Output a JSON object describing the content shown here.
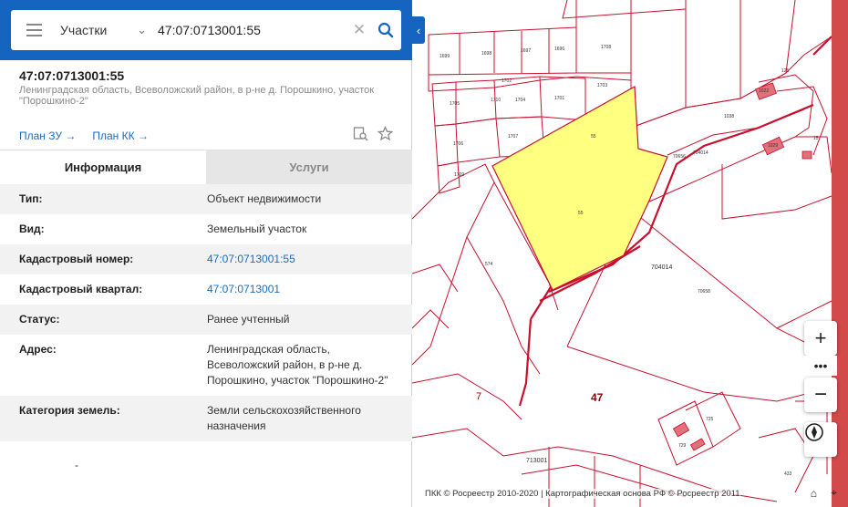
{
  "search": {
    "scope": "Участки",
    "query": "47:07:0713001:55"
  },
  "object": {
    "cadastral_number": "47:07:0713001:55",
    "address_short": "Ленинградская область, Всеволожский район, в р-не д. Порошкино, участок \"Порошкино-2\"",
    "link_plan_zu": "План ЗУ →",
    "link_plan_kk": "План КК →"
  },
  "tabs": [
    {
      "label": "Информация"
    },
    {
      "label": "Услуги"
    }
  ],
  "info": [
    {
      "key": "Тип:",
      "value": "Объект недвижимости"
    },
    {
      "key": "Вид:",
      "value": "Земельный участок"
    },
    {
      "key": "Кадастровый номер:",
      "value": "47:07:0713001:55"
    },
    {
      "key": "Кадастровый квартал:",
      "value": "47:07:0713001"
    },
    {
      "key": "Статус:",
      "value": "Ранее учтенный"
    },
    {
      "key": "Адрес:",
      "value": "Ленинградская область, Всеволожский район, в р-не д. Порошкино, участок \"Порошкино-2\""
    },
    {
      "key": "Категория земель:",
      "value": "Земли сельскохозяйственного назначения"
    }
  ],
  "trailing_dash": "-",
  "map": {
    "attribution": "ПКК © Росреестр 2010-2020 | Картографическая основа РФ © Росреестр 2011",
    "highlight_color": "#ffff80",
    "boundary_color": "#c8102e",
    "labels": {
      "l1699": "1699",
      "l1698": "1698",
      "l1697": "1697",
      "l1696": "1696",
      "l1708": "1708",
      "l1703": "1703",
      "l1702": "1702",
      "l1705": "1705",
      "l1701": "1701",
      "l1704": "1704",
      "l1706": "1706",
      "l1707": "1707",
      "l1709": "1709",
      "l1710": "1710",
      "l55a": "55",
      "l55b": "55",
      "l574": "574",
      "l704014a": "704014",
      "l704014b": "704014",
      "l70658": "70658",
      "l70656": "70656",
      "l7": "7",
      "l47": "47",
      "l713001": "713001",
      "l1029": "1029",
      "l1022": "1022",
      "l1038": "1038",
      "l125": "125",
      "l15": "15",
      "l725": "725",
      "l729": "729",
      "l433": "433"
    }
  }
}
